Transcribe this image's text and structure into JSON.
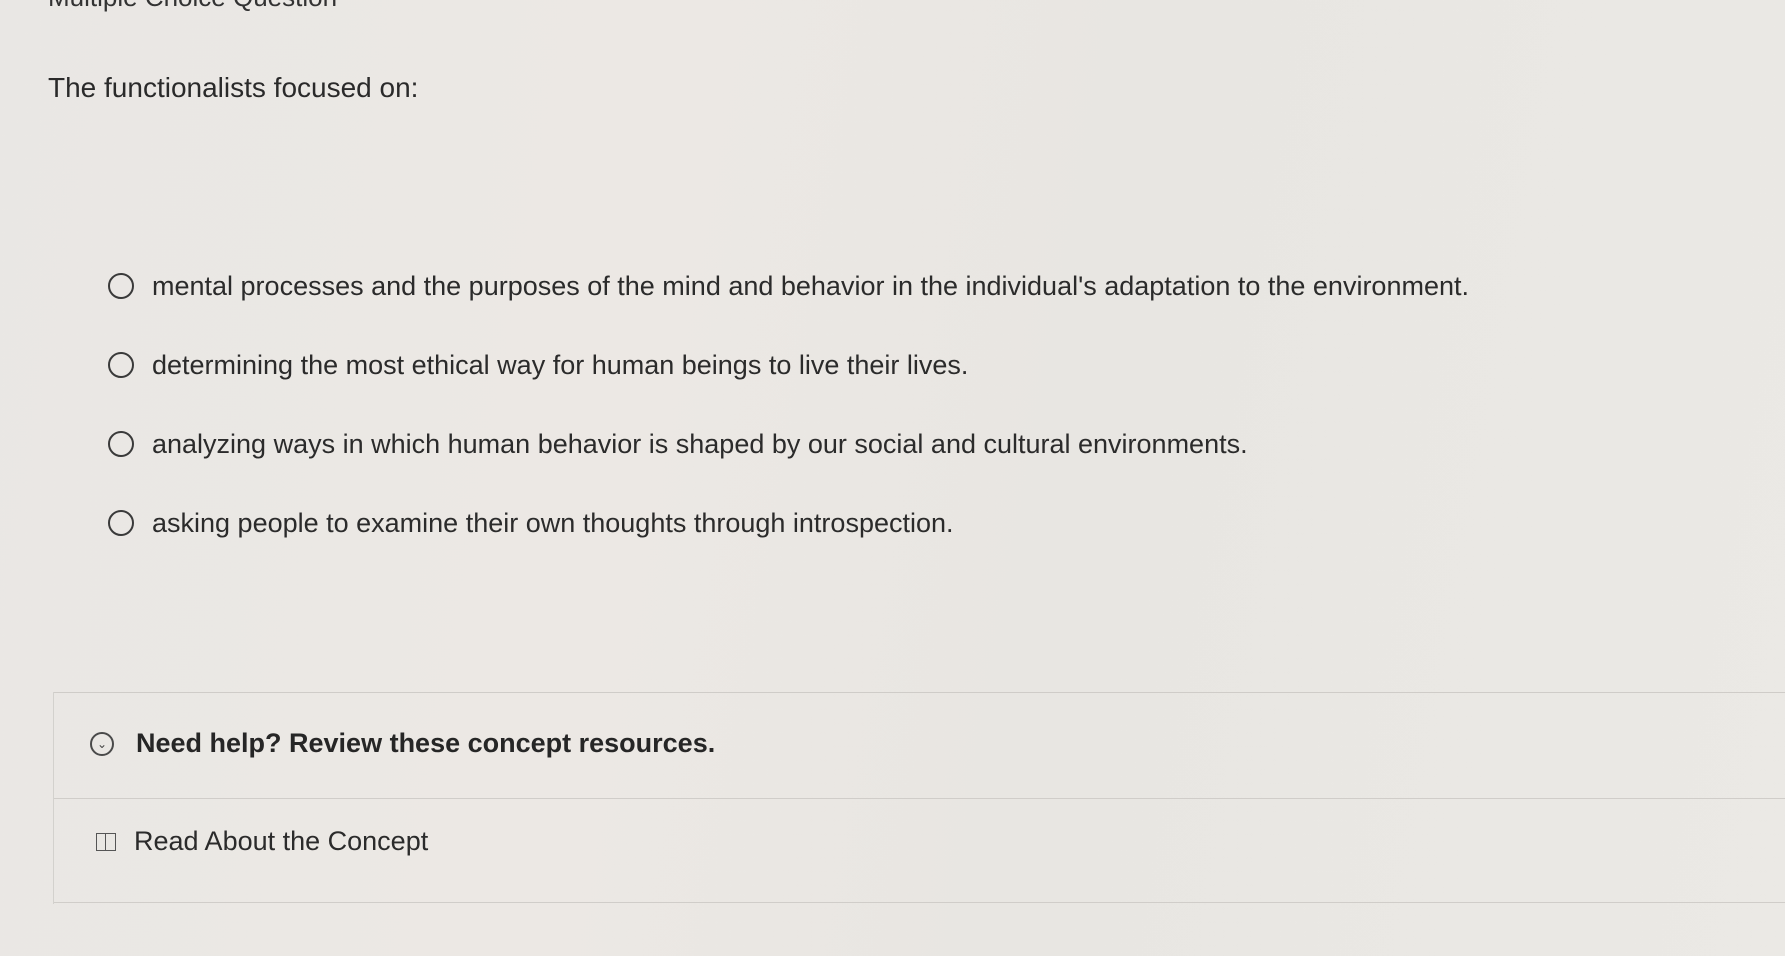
{
  "header": {
    "question_type_label": "Multiple Choice Question"
  },
  "question": {
    "prompt": "The functionalists focused on:",
    "options": [
      {
        "label": "mental processes and the purposes of the mind and behavior in the individual's adaptation to the environment."
      },
      {
        "label": "determining the most ethical way for human beings to live their lives."
      },
      {
        "label": "analyzing ways in which human behavior is shaped by our social and cultural environments."
      },
      {
        "label": "asking people to examine their own thoughts through introspection."
      }
    ]
  },
  "help": {
    "title": "Need help? Review these concept resources.",
    "toggle_icon": "chevron-down-circle-icon",
    "resources": [
      {
        "label": "Read About the Concept",
        "icon": "book-icon"
      }
    ]
  }
}
